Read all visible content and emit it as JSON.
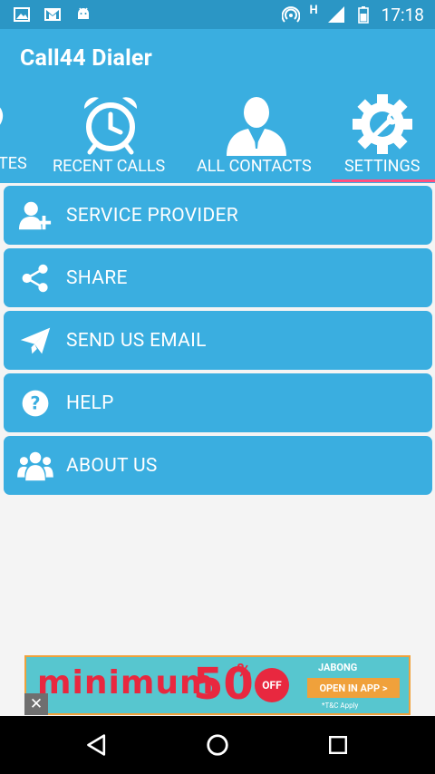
{
  "status_bar": {
    "time": "17:18",
    "network": "H",
    "icons": [
      "image-icon",
      "gmail-icon",
      "android-icon",
      "hotspot-icon",
      "signal-icon",
      "battery-icon"
    ]
  },
  "app": {
    "title": "Call44 Dialer"
  },
  "tabs": [
    {
      "label": "TES",
      "icon": "heart-icon",
      "selected": false
    },
    {
      "label": "RECENT CALLS",
      "icon": "alarm-clock-icon",
      "selected": false
    },
    {
      "label": "ALL CONTACTS",
      "icon": "person-icon",
      "selected": false
    },
    {
      "label": "SETTINGS",
      "icon": "gear-wrench-icon",
      "selected": true
    }
  ],
  "menu": [
    {
      "label": "SERVICE PROVIDER",
      "icon": "add-user-icon"
    },
    {
      "label": "SHARE",
      "icon": "share-icon"
    },
    {
      "label": "SEND US EMAIL",
      "icon": "paper-plane-icon"
    },
    {
      "label": "HELP",
      "icon": "question-icon"
    },
    {
      "label": "ABOUT US",
      "icon": "group-icon"
    }
  ],
  "ad": {
    "text": "minimum",
    "big": "50",
    "pct": "%",
    "off": "OFF",
    "brand": "JABONG",
    "button": "OPEN IN APP >",
    "note": "*T&C Apply",
    "close": "✕"
  },
  "colors": {
    "primary": "#3aaee0",
    "status": "#2b96c5",
    "indicator": "#ff4f7e",
    "background": "#f4f4f4"
  }
}
